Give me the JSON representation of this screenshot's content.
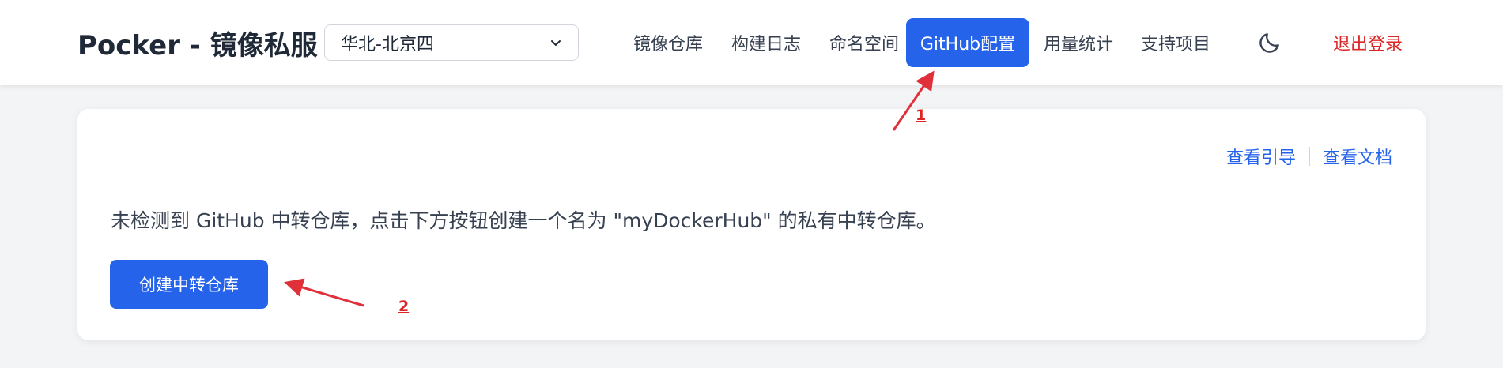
{
  "header": {
    "brand": "Pocker - 镜像私服",
    "region_select": {
      "value": "华北-北京四"
    },
    "nav": [
      {
        "label": "镜像仓库"
      },
      {
        "label": "构建日志"
      },
      {
        "label": "命名空间"
      },
      {
        "label": "GitHub配置",
        "active": true
      },
      {
        "label": "用量统计"
      },
      {
        "label": "支持项目"
      }
    ],
    "theme_icon": "moon-icon",
    "logout_label": "退出登录"
  },
  "card": {
    "links": {
      "guide": "查看引导",
      "docs": "查看文档"
    },
    "message": "未检测到 GitHub 中转仓库，点击下方按钮创建一个名为 \"myDockerHub\" 的私有中转仓库。",
    "create_button": "创建中转仓库"
  },
  "annotations": {
    "marker_1": "1",
    "marker_2": "2"
  },
  "colors": {
    "primary": "#2563eb",
    "danger": "#dc2626",
    "background": "#f3f4f6",
    "annotation": "#e0303a"
  }
}
